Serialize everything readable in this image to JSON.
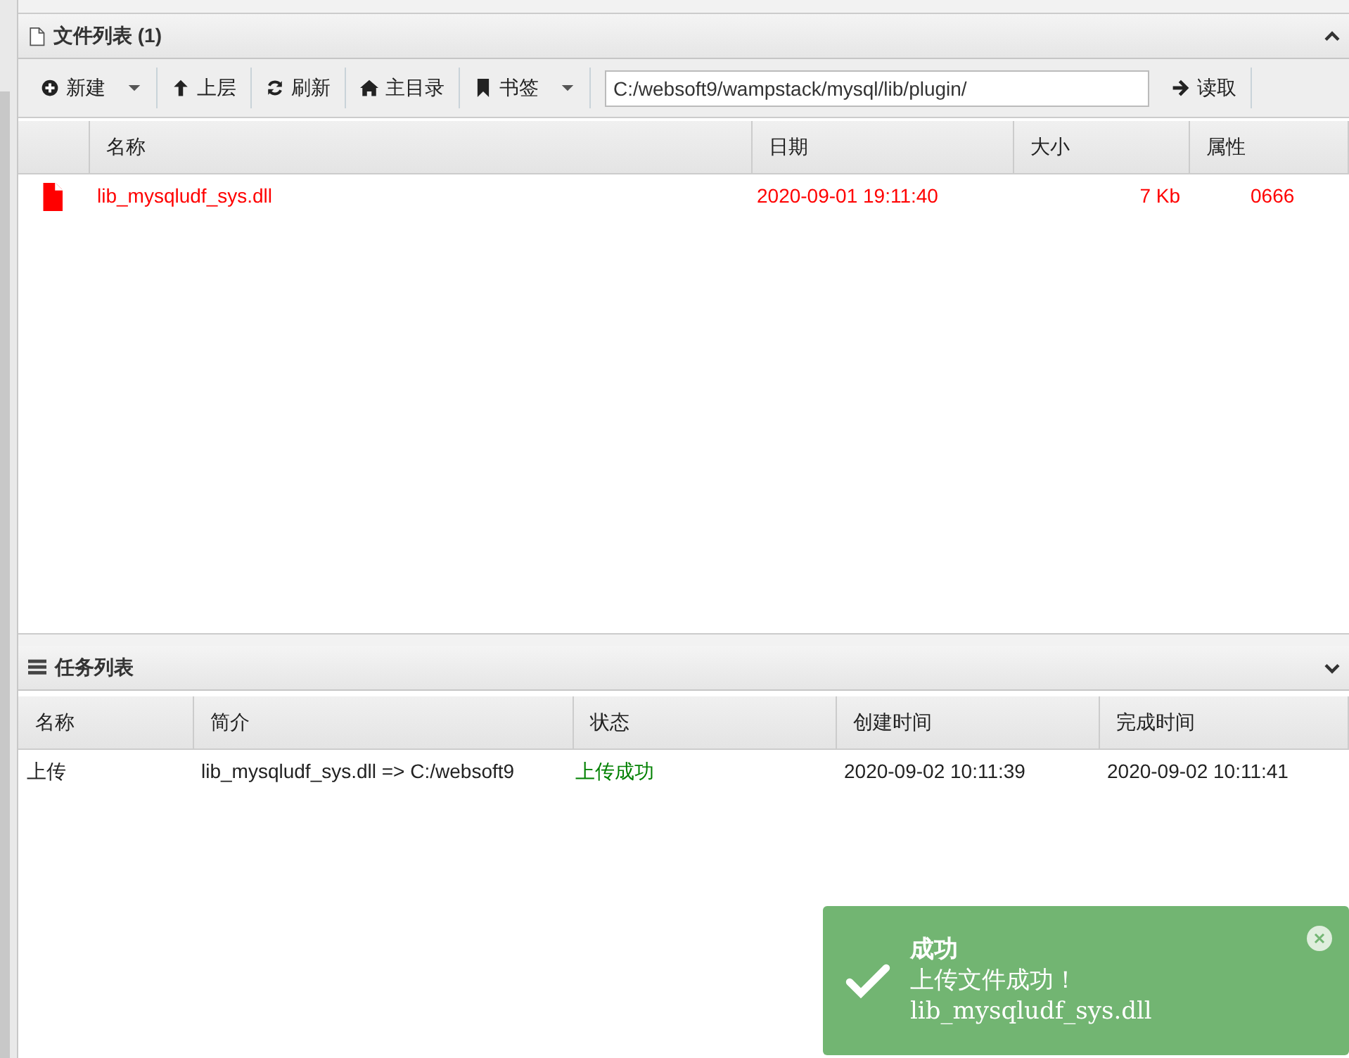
{
  "file_panel": {
    "title": "文件列表 (1)",
    "expanded": true
  },
  "toolbar": [
    {
      "label": "新建",
      "kind": "dropdown"
    },
    {
      "label": "上层",
      "kind": "button"
    },
    {
      "label": "刷新",
      "kind": "button"
    },
    {
      "label": "主目录",
      "kind": "button"
    },
    {
      "label": "书签",
      "kind": "dropdown"
    }
  ],
  "path_field": {
    "value": "C:/websoft9/wampstack/mysql/lib/plugin/"
  },
  "read_button": {
    "label": "读取"
  },
  "files": {
    "columns": [
      "名称",
      "日期",
      "大小",
      "属性"
    ],
    "rows": [
      {
        "name": "lib_mysqludf_sys.dll",
        "date": "2020-09-01 19:11:40",
        "size": "7 Kb",
        "perms": "0666",
        "color": "#ff0000"
      }
    ]
  },
  "task_panel": {
    "title": "任务列表",
    "expanded": false
  },
  "tasks": {
    "columns": [
      "名称",
      "简介",
      "状态",
      "创建时间",
      "完成时间"
    ],
    "rows": [
      {
        "name": "上传",
        "summary": "lib_mysqludf_sys.dll => C:/websoft9",
        "status": "上传成功",
        "created": "2020-09-02 10:11:39",
        "finished": "2020-09-02 10:11:41"
      }
    ]
  },
  "toast": {
    "title": "成功",
    "message": "上传文件成功！",
    "detail": "lib_mysqludf_sys.dll"
  }
}
